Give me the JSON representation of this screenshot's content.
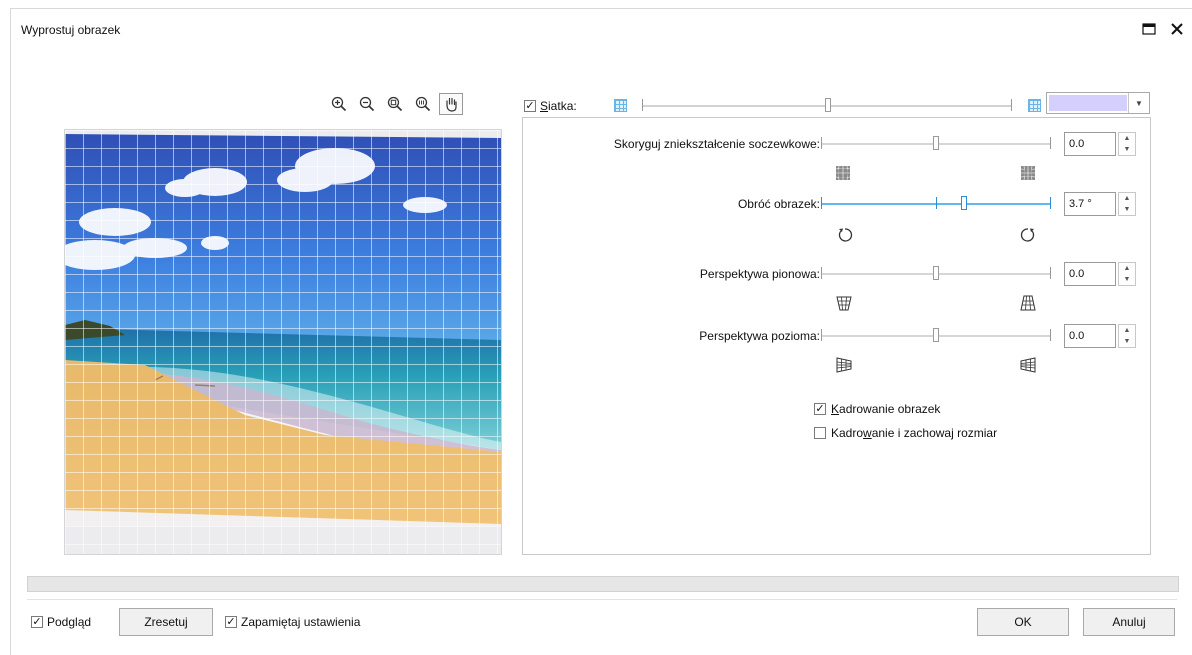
{
  "window": {
    "title": "Wyprostuj obrazek",
    "maximize_icon": "maximize-icon",
    "close_icon": "close-icon"
  },
  "zoom_tools": [
    "zoom-in-icon",
    "zoom-out-icon",
    "zoom-fit-icon",
    "zoom-100-icon",
    "hand-pan-icon"
  ],
  "grid": {
    "checked": true,
    "label": "Siatka:",
    "slider_position": 0.5,
    "color_swatch": "#d4d0fb",
    "color_accent": "#6bb5e6"
  },
  "controls": {
    "lens": {
      "label": "Skoryguj zniekształcenie soczewkowe:",
      "value": "0.0"
    },
    "rotate": {
      "label": "Obróć obrazek:",
      "value": "3.7 °",
      "slider_position": 0.62
    },
    "vertical": {
      "label": "Perspektywa pionowa:",
      "value": "0.0"
    },
    "horizontal": {
      "label": "Perspektywa pozioma:",
      "value": "0.0"
    }
  },
  "options": {
    "crop": {
      "label_pre": "",
      "label_u": "K",
      "label_post": "adrowanie obrazek",
      "checked": true
    },
    "crop_keep": {
      "label_pre": "Kadro",
      "label_u": "w",
      "label_post": "anie i zachowaj rozmiar",
      "checked": false
    }
  },
  "footer": {
    "preview_label": "Podgląd",
    "reset_label": "Zresetuj",
    "remember_label": "Zapamiętaj ustawienia",
    "ok_label": "OK",
    "cancel_label": "Anuluj"
  }
}
